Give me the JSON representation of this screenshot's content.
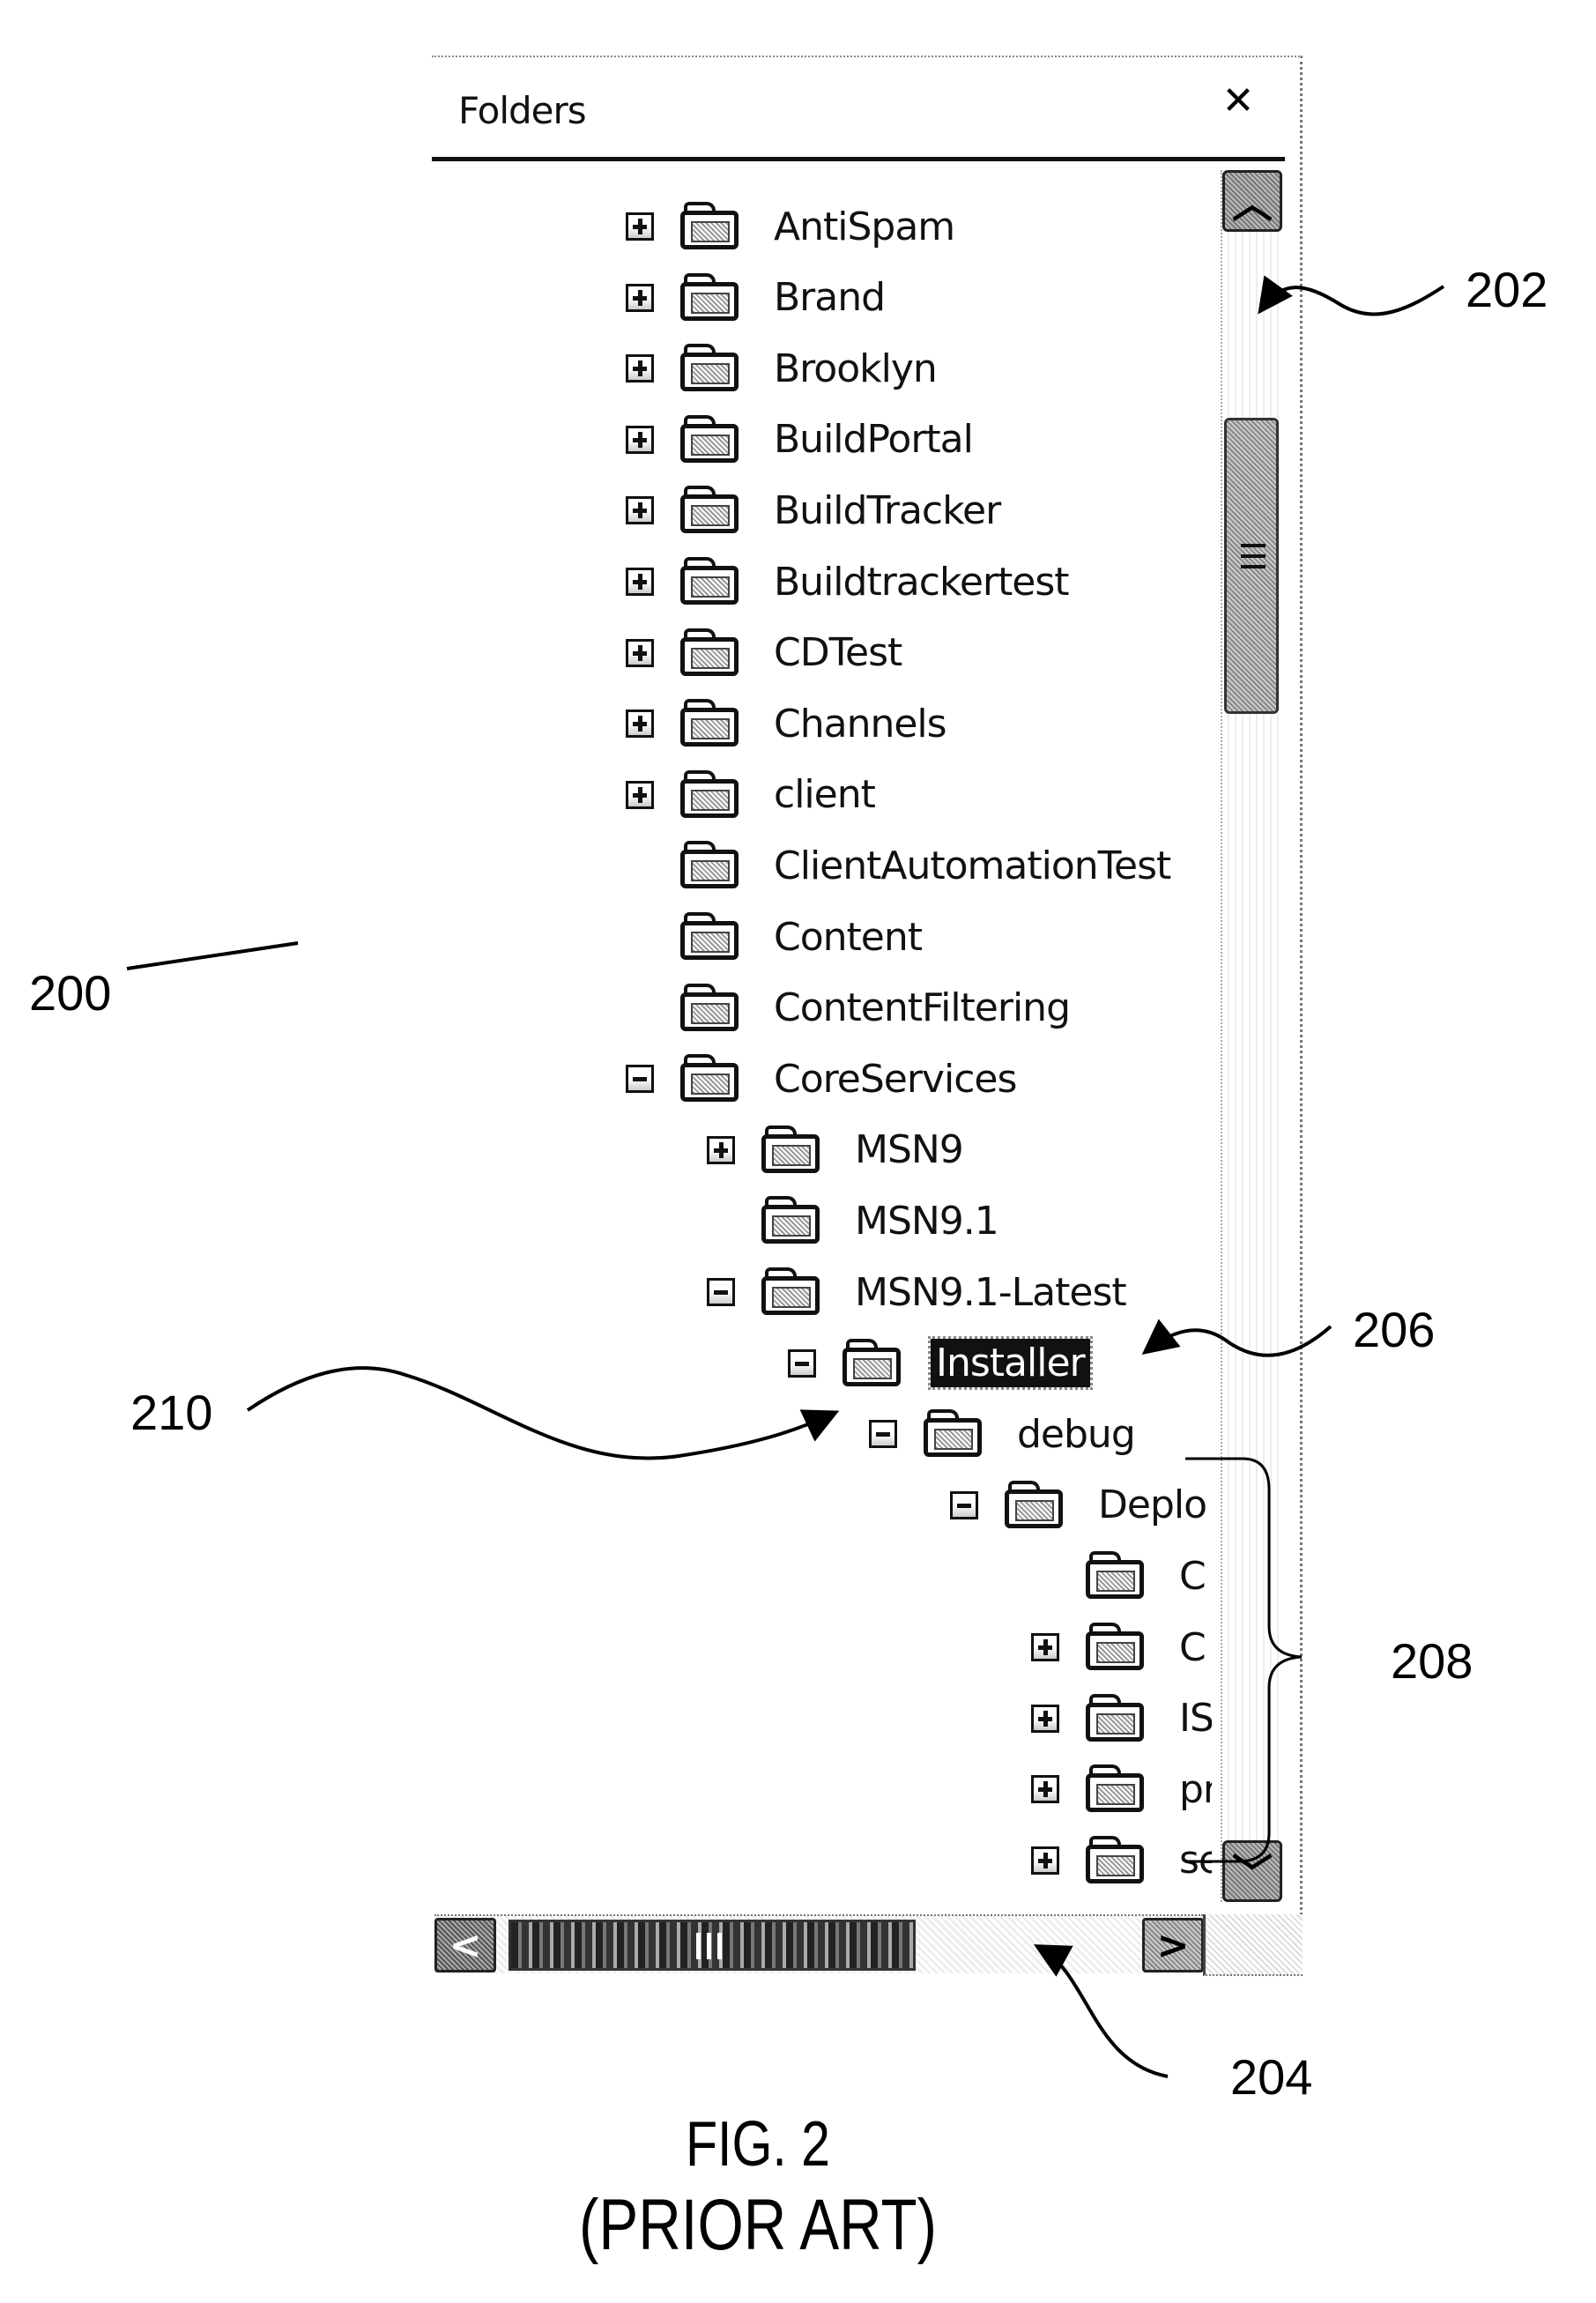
{
  "panel": {
    "title": "Folders",
    "close_icon": "×"
  },
  "tree": [
    {
      "label": "AntiSpam",
      "level": 0,
      "expander": "plus"
    },
    {
      "label": "Brand",
      "level": 0,
      "expander": "plus"
    },
    {
      "label": "Brooklyn",
      "level": 0,
      "expander": "plus"
    },
    {
      "label": "BuildPortal",
      "level": 0,
      "expander": "plus"
    },
    {
      "label": "BuildTracker",
      "level": 0,
      "expander": "plus"
    },
    {
      "label": "Buildtrackertest",
      "level": 0,
      "expander": "plus"
    },
    {
      "label": "CDTest",
      "level": 0,
      "expander": "plus"
    },
    {
      "label": "Channels",
      "level": 0,
      "expander": "plus"
    },
    {
      "label": "client",
      "level": 0,
      "expander": "plus"
    },
    {
      "label": "ClientAutomationTest",
      "level": 0,
      "expander": "none"
    },
    {
      "label": "Content",
      "level": 0,
      "expander": "none"
    },
    {
      "label": "ContentFiltering",
      "level": 0,
      "expander": "none"
    },
    {
      "label": "CoreServices",
      "level": 0,
      "expander": "minus"
    },
    {
      "label": "MSN9",
      "level": 1,
      "expander": "plus"
    },
    {
      "label": "MSN9.1",
      "level": 1,
      "expander": "none"
    },
    {
      "label": "MSN9.1-Latest",
      "level": 1,
      "expander": "minus"
    },
    {
      "label": "Installer",
      "level": 2,
      "expander": "minus",
      "selected": true
    },
    {
      "label": "debug",
      "level": 3,
      "expander": "minus"
    },
    {
      "label": "Deplo",
      "level": 4,
      "expander": "minus"
    },
    {
      "label": "C",
      "level": 5,
      "expander": "none"
    },
    {
      "label": "C",
      "level": 5,
      "expander": "plus"
    },
    {
      "label": "IS",
      "level": 5,
      "expander": "plus"
    },
    {
      "label": "pr",
      "level": 5,
      "expander": "plus"
    },
    {
      "label": "se",
      "level": 5,
      "expander": "plus"
    }
  ],
  "scrollbars": {
    "vertical": {
      "up_icon": "⌃",
      "down_icon": "⌄",
      "position_fraction": 0.15
    },
    "horizontal": {
      "left_icon": "‹",
      "right_icon": "›",
      "position_fraction": 0.0
    }
  },
  "annotations": {
    "ref_200": "200",
    "ref_202": "202",
    "ref_204": "204",
    "ref_206": "206",
    "ref_208": "208",
    "ref_210": "210"
  },
  "caption": {
    "figure": "FIG. 2",
    "subtitle": "(PRIOR ART)"
  }
}
